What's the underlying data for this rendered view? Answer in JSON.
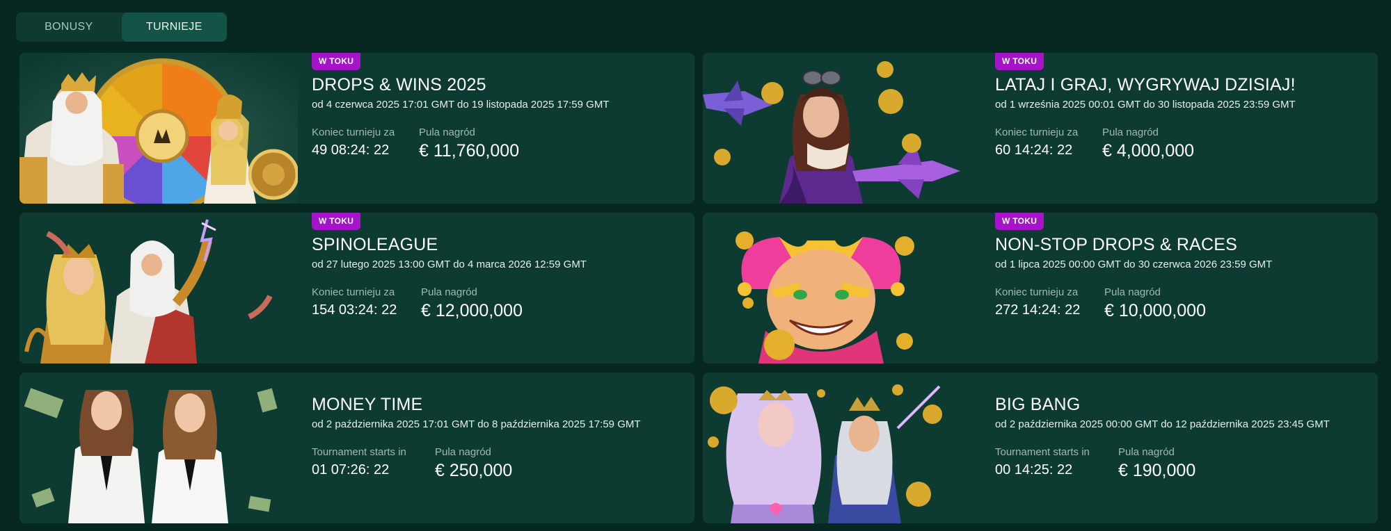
{
  "tabs": [
    {
      "label": "BONUSY",
      "active": false
    },
    {
      "label": "TURNIEJE",
      "active": true
    }
  ],
  "colors": {
    "background": "#072721",
    "card": "#0d3a31",
    "badge": "#a514c9",
    "tab_active": "#145446"
  },
  "tournaments": [
    {
      "badge": "W TOKU",
      "title": "DROPS & WINS 2025",
      "dates": "od 4 czerwca 2025 17:01 GMT do 19 listopada 2025 17:59 GMT",
      "timer_label": "Koniec turnieju za",
      "timer_value": "49 08:24: 22",
      "prize_label": "Pula nagród",
      "prize_value": "€ 11,760,000",
      "image": "zeus-athena-prize-wheel"
    },
    {
      "badge": "W TOKU",
      "title": "LATAJ I GRAJ, WYGRYWAJ DZISIAJ!",
      "dates": "od 1 września 2025 00:01 GMT do 30 listopada 2025 23:59 GMT",
      "timer_label": "Koniec turnieju za",
      "timer_value": "60 14:24: 22",
      "prize_label": "Pula nagród",
      "prize_value": "€ 4,000,000",
      "image": "aviator-girl-planes-coins"
    },
    {
      "badge": "W TOKU",
      "title": "SPINOLEAGUE",
      "dates": "od 27 lutego 2025 13:00 GMT do 4 marca 2026 12:59 GMT",
      "timer_label": "Koniec turnieju za",
      "timer_value": "154 03:24: 22",
      "prize_label": "Pula nagród",
      "prize_value": "€ 12,000,000",
      "image": "zeus-goddess-lightning"
    },
    {
      "badge": "W TOKU",
      "title": "NON-STOP DROPS & RACES",
      "dates": "od 1 lipca 2025 00:00 GMT do 30 czerwca 2026 23:59 GMT",
      "timer_label": "Koniec turnieju za",
      "timer_value": "272 14:24: 22",
      "prize_label": "Pula nagród",
      "prize_value": "€ 10,000,000",
      "image": "joker-coins"
    },
    {
      "badge": "",
      "title": "MONEY TIME",
      "dates": "od 2 października 2025 17:01 GMT do 8 października 2025 17:59 GMT",
      "timer_label": "Tournament starts in",
      "timer_value": "01 07:26: 22",
      "prize_label": "Pula nagród",
      "prize_value": "€ 250,000",
      "image": "two-women-white-suits-money"
    },
    {
      "badge": "",
      "title": "BIG BANG",
      "dates": "od 2 października 2025 00:00 GMT do 12 października 2025 23:45 GMT",
      "timer_label": "Tournament starts in",
      "timer_value": "00 14:25: 22",
      "prize_label": "Pula nagród",
      "prize_value": "€ 190,000",
      "image": "goddess-neptune-coins"
    }
  ]
}
